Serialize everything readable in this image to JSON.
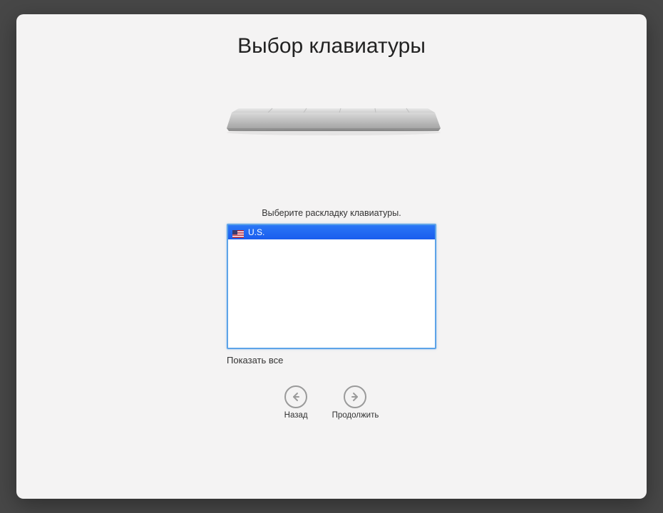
{
  "title": "Выбор клавиатуры",
  "instruction": "Выберите раскладку клавиатуры.",
  "layouts": [
    {
      "label": "U.S.",
      "selected": true,
      "flag": "us"
    }
  ],
  "show_all_label": "Показать все",
  "nav": {
    "back_label": "Назад",
    "continue_label": "Продолжить"
  }
}
